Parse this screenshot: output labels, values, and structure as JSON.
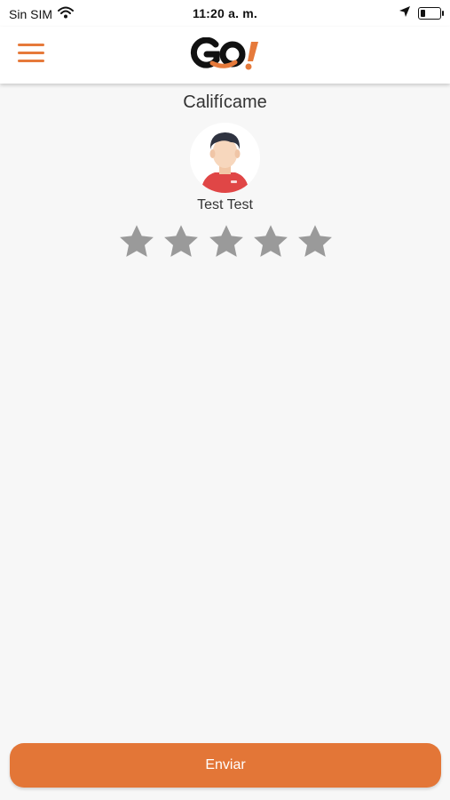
{
  "status_bar": {
    "carrier": "Sin SIM",
    "time": "11:20 a. m.",
    "icons": [
      "wifi-icon",
      "location-arrow-icon",
      "battery-icon"
    ]
  },
  "header": {
    "menu_icon": "hamburger-menu-icon",
    "logo": {
      "text": "GO!",
      "colors": {
        "letters": "#111111",
        "exclamation": "#e67a3b"
      }
    }
  },
  "rating": {
    "title": "Califícame",
    "avatar_icon": "driver-avatar-icon",
    "name": "Test Test",
    "max_stars": 5,
    "selected_stars": 0,
    "star_color": "#9a9a9a"
  },
  "footer": {
    "submit_label": "Enviar"
  },
  "colors": {
    "accent": "#e37637",
    "background": "#f7f7f7",
    "header_background": "#ffffff"
  }
}
